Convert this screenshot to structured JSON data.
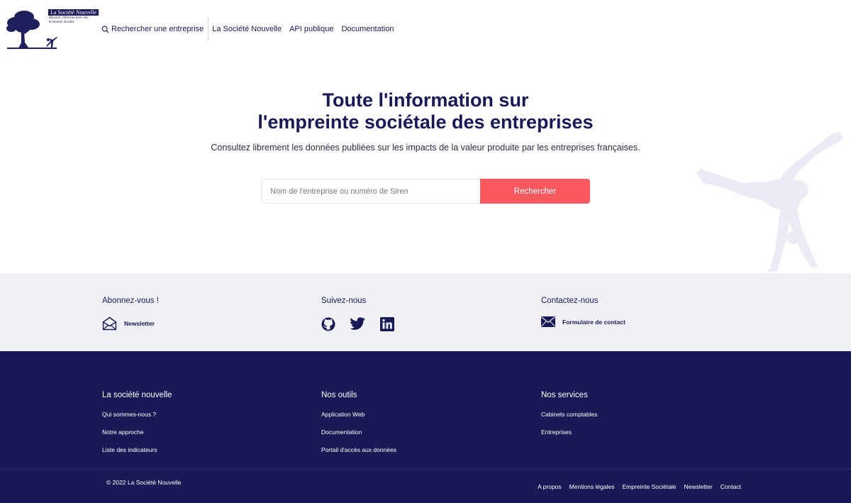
{
  "brand": {
    "name": "La Société Nouvelle",
    "tagline": "Mesurer, Informer pour une économie durable"
  },
  "nav": {
    "items": [
      {
        "label": "Rechercher une entreprise",
        "icon": "search-icon"
      },
      {
        "label": "La Société Nouvelle"
      },
      {
        "label": "API publique"
      },
      {
        "label": "Documentation"
      }
    ]
  },
  "hero": {
    "title_line1": "Toute l'information sur",
    "title_bold": "l'empreinte sociétale",
    "title_rest": " des entreprises",
    "subtitle": "Consultez librement les données publiées sur les impacts de la valeur produite par les entreprises françaises."
  },
  "search": {
    "placeholder": "Nom de l'entreprise ou numéro de Siren",
    "value": "",
    "button_label": "Rechercher"
  },
  "band": {
    "subscribe": {
      "title": "Abonnez-vous !",
      "link": "Newsletter",
      "icon": "envelope-open-icon"
    },
    "follow": {
      "title": "Suivez-nous",
      "icons": [
        "github-icon",
        "twitter-icon",
        "linkedin-icon"
      ]
    },
    "contact": {
      "title": "Contactez-nous",
      "link": "Formulaire de contact",
      "icon": "envelope-icon"
    }
  },
  "footer": {
    "columns": [
      {
        "title": "La société nouvelle",
        "links": [
          "Qui sommes-nous ?",
          "Notre approche",
          "Liste des indicateurs"
        ]
      },
      {
        "title": "Nos outils",
        "links": [
          "Application Web",
          "Documentation",
          "Portail d'accès aux données"
        ]
      },
      {
        "title": "Nos services",
        "links": [
          "Cabinets comptables",
          "Entreprises"
        ]
      }
    ],
    "copyright": "© 2022 La Société Nouvelle",
    "bottom_links": [
      "A propos",
      "Mentions légales",
      "Empreinte Sociétale",
      "Newsletter",
      "Contact"
    ]
  },
  "colors": {
    "navy": "#191956",
    "accent": "#fa595f",
    "band_bg": "#f0f0f7",
    "silhouette": "#ebebf5"
  }
}
